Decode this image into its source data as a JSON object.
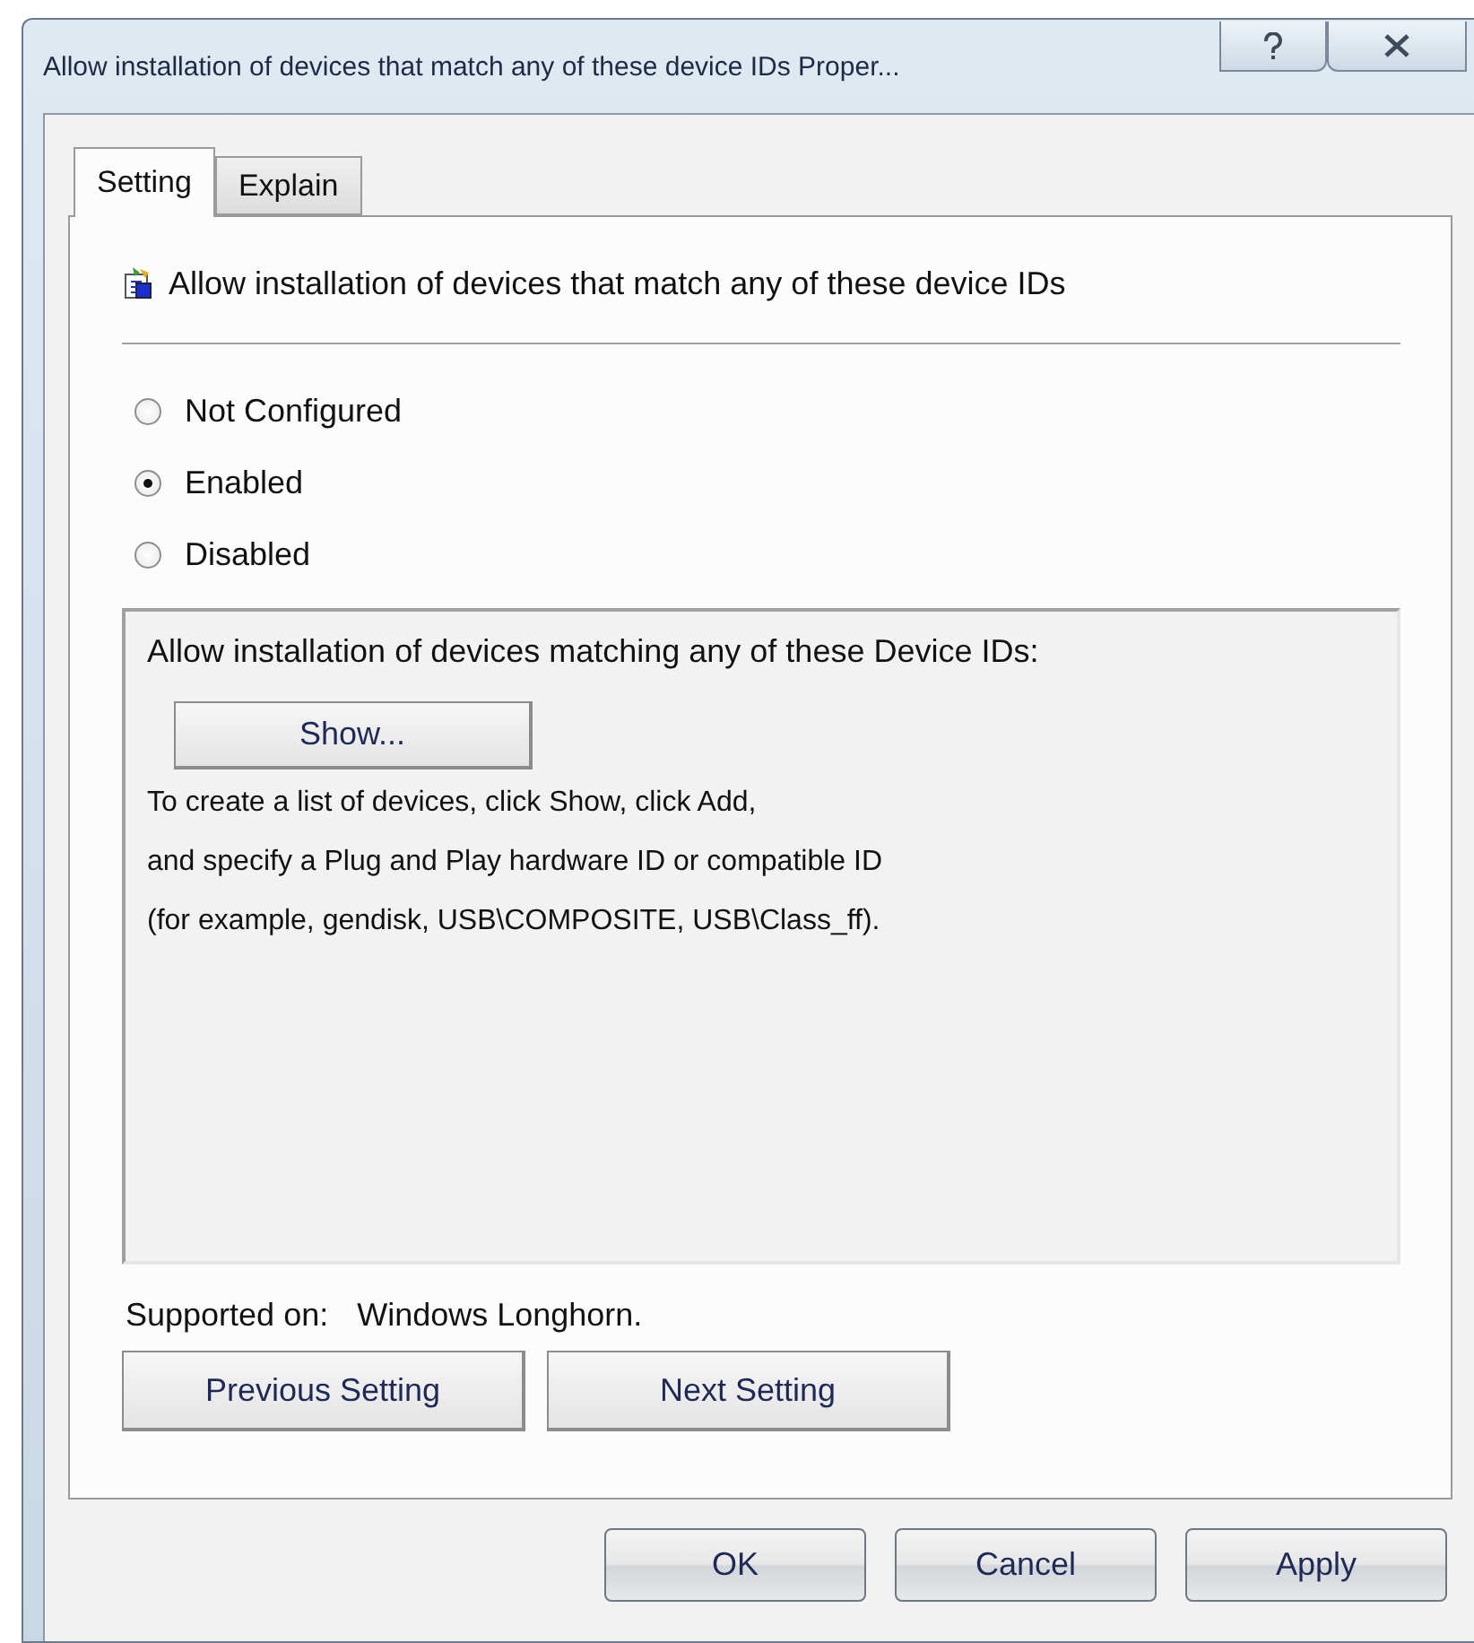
{
  "window": {
    "title": "Allow installation of devices that match any of these device IDs Proper..."
  },
  "tabs": [
    {
      "label": "Setting",
      "selected": true
    },
    {
      "label": "Explain",
      "selected": false
    }
  ],
  "policy": {
    "name": "Allow installation of devices that match any of these device IDs"
  },
  "options": [
    {
      "label": "Not Configured",
      "selected": false
    },
    {
      "label": "Enabled",
      "selected": true
    },
    {
      "label": "Disabled",
      "selected": false
    }
  ],
  "options_box": {
    "label": "Allow installation of devices matching any of these Device IDs:",
    "show_button": "Show...",
    "description": "To create a list of devices, click Show, click Add,\nand specify a Plug and Play hardware ID or compatible ID\n(for example, gendisk, USB\\COMPOSITE, USB\\Class_ff)."
  },
  "supported_on": {
    "label": "Supported on:",
    "value": "Windows Longhorn."
  },
  "nav_buttons": [
    "Previous Setting",
    "Next Setting"
  ],
  "dialog_buttons": [
    "OK",
    "Cancel",
    "Apply"
  ]
}
